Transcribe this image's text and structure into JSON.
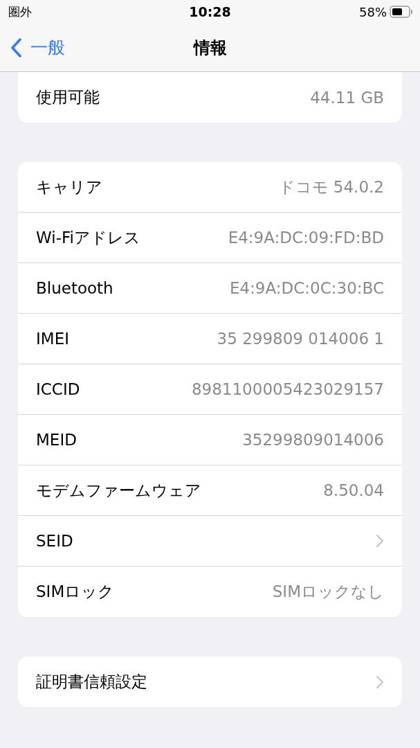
{
  "status_bar": {
    "carrier": "圏外",
    "time": "10:28",
    "battery": "58%"
  },
  "nav": {
    "back": "一般",
    "title": "情報"
  },
  "sections": [
    {
      "rows": [
        {
          "kind": "value",
          "label": "使用可能",
          "value": "44.11 GB"
        }
      ]
    },
    {
      "rows": [
        {
          "kind": "value",
          "label": "キャリア",
          "value": "ドコモ 54.0.2"
        },
        {
          "kind": "value",
          "label": "Wi-Fiアドレス",
          "value": "E4:9A:DC:09:FD:BD"
        },
        {
          "kind": "value",
          "label": "Bluetooth",
          "value": "E4:9A:DC:0C:30:BC"
        },
        {
          "kind": "value",
          "label": "IMEI",
          "value": "35 299809 014006 1"
        },
        {
          "kind": "value",
          "label": "ICCID",
          "value": "8981100005423029157"
        },
        {
          "kind": "value",
          "label": "MEID",
          "value": "35299809014006"
        },
        {
          "kind": "value",
          "label": "モデムファームウェア",
          "value": "8.50.04"
        },
        {
          "kind": "chevron",
          "label": "SEID"
        },
        {
          "kind": "value",
          "label": "SIMロック",
          "value": "SIMロックなし"
        }
      ]
    },
    {
      "rows": [
        {
          "kind": "chevron",
          "label": "証明書信頼設定"
        }
      ]
    }
  ]
}
